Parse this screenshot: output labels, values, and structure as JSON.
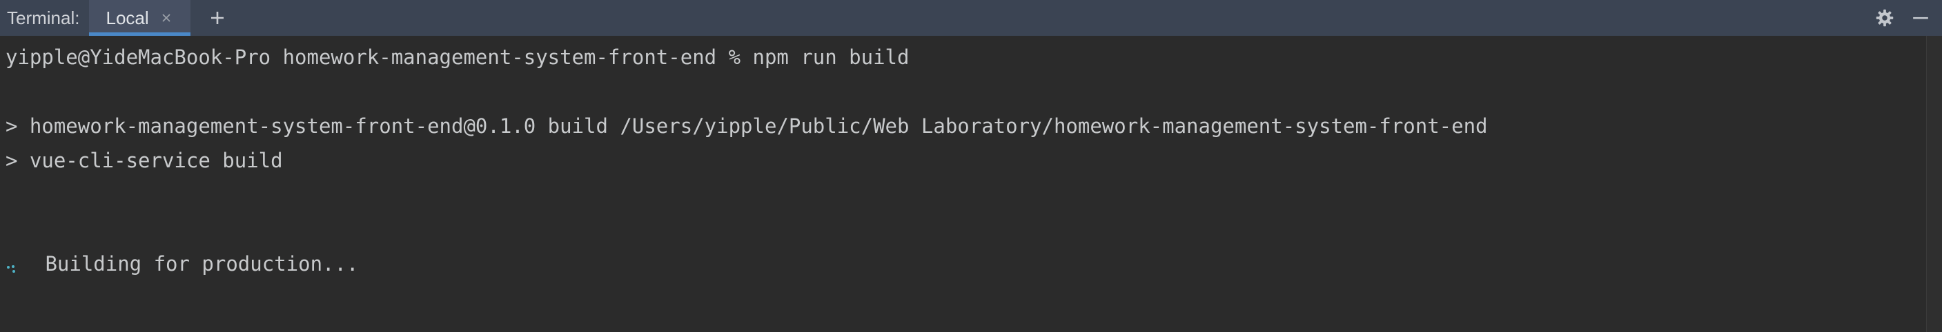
{
  "header": {
    "title": "Terminal:",
    "tabs": [
      {
        "label": "Local",
        "active": true
      }
    ],
    "add_tab_icon": "plus-icon",
    "settings_icon": "gear-icon",
    "hide_icon": "minimize-icon"
  },
  "terminal": {
    "lines": [
      "yipple@YideMacBook-Pro homework-management-system-front-end % npm run build",
      "> homework-management-system-front-end@0.1.0 build /Users/yipple/Public/Web Laboratory/homework-management-system-front-end",
      "> vue-cli-service build",
      " Building for production..."
    ],
    "spinner_icon": "spinner-icon"
  },
  "colors": {
    "header_bg": "#3b4453",
    "tab_active_bg": "#475063",
    "tab_underline": "#4a88c7",
    "terminal_bg": "#2b2b2b",
    "terminal_text": "#c8cacc",
    "spinner": "#4fb3c6"
  }
}
